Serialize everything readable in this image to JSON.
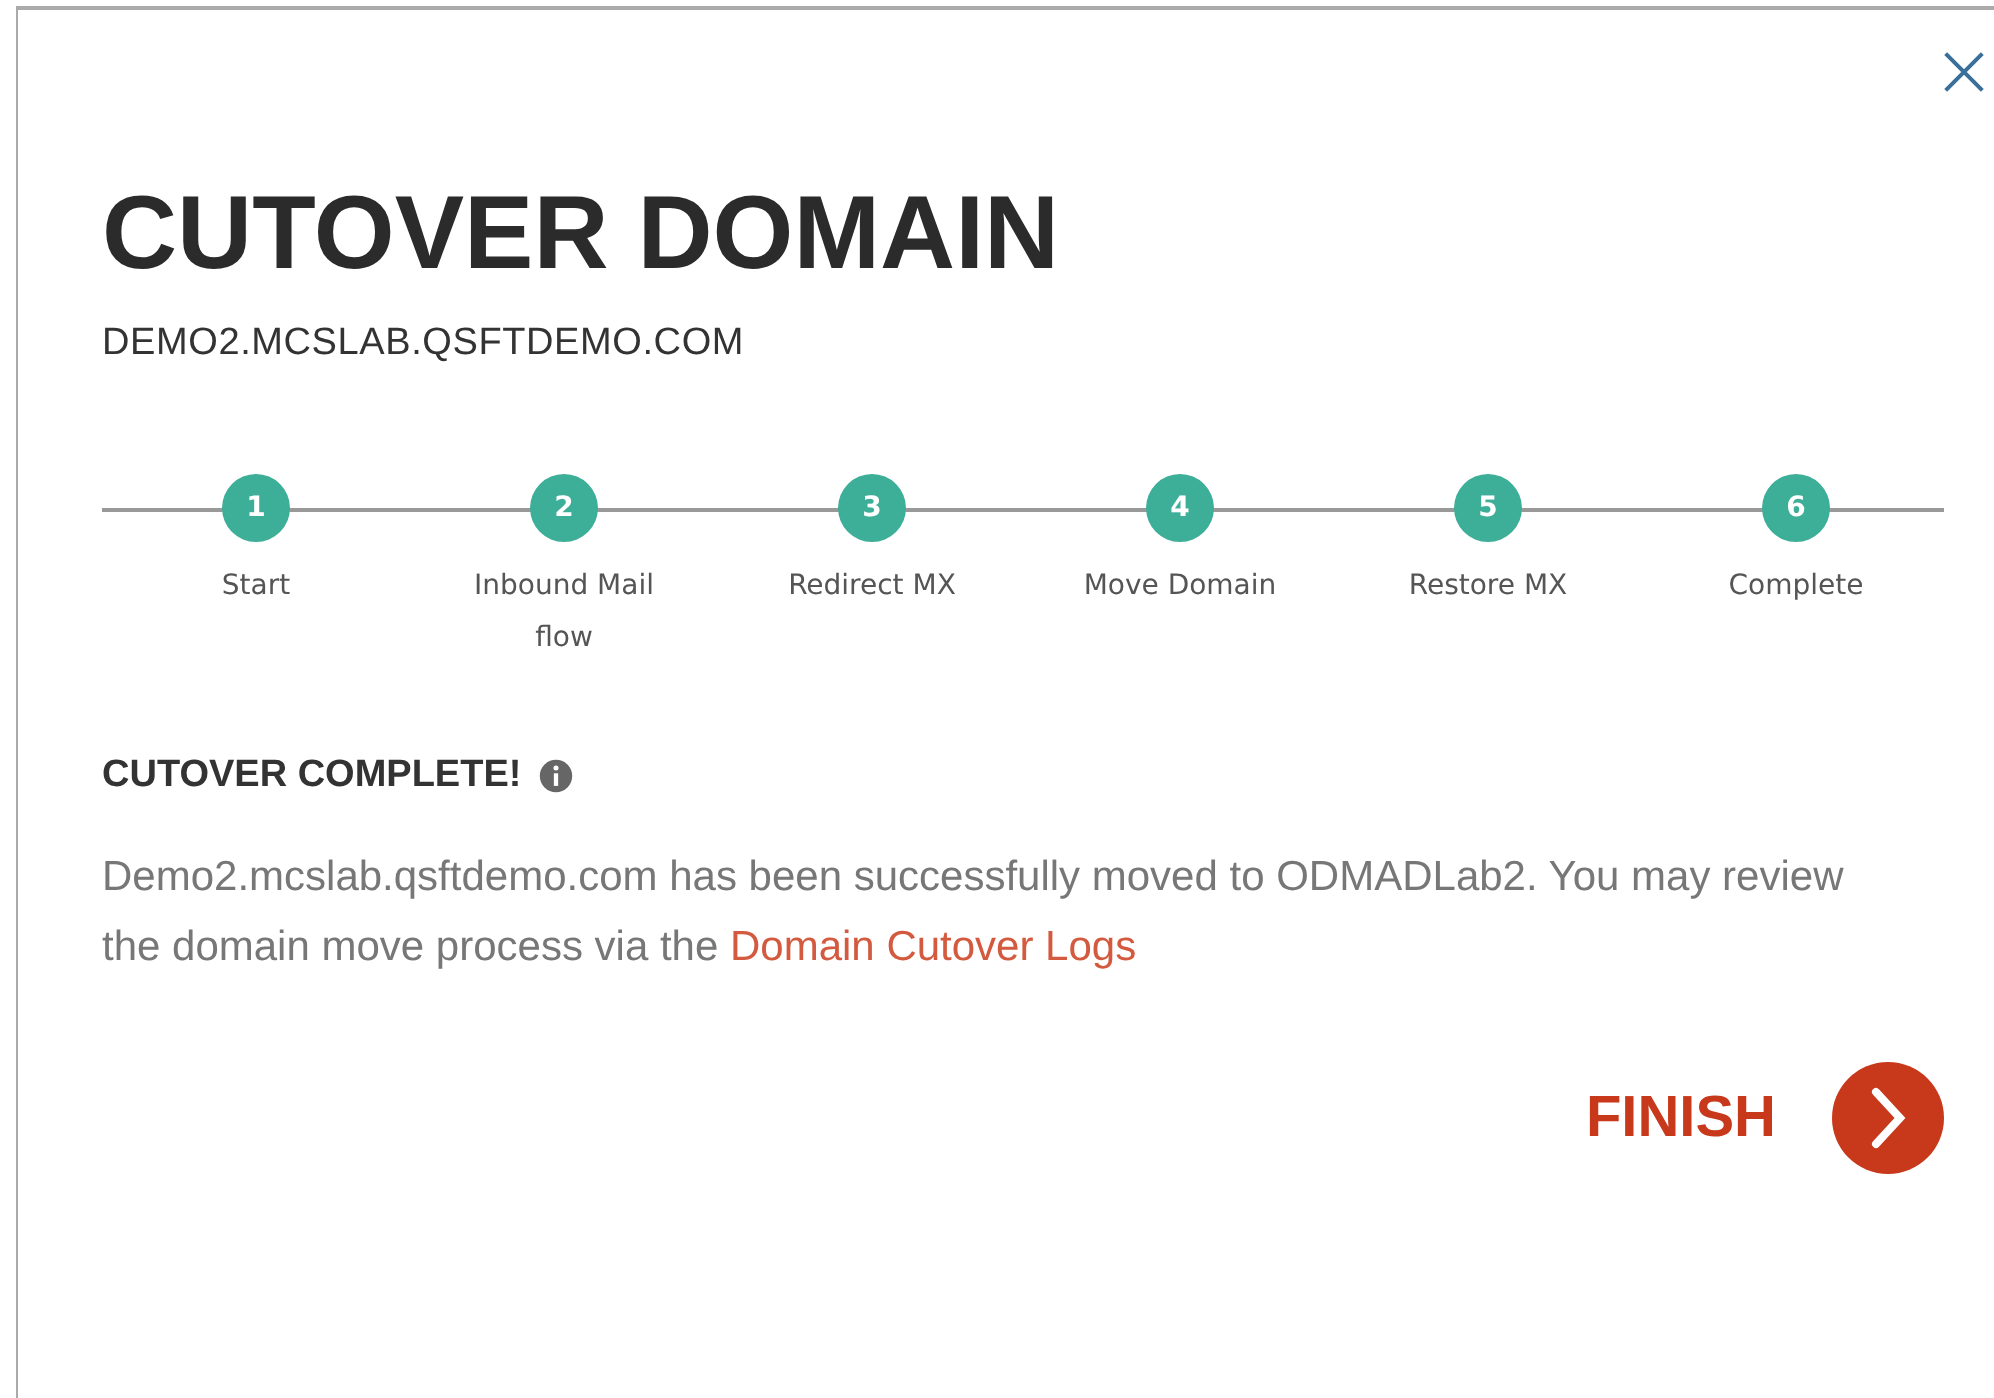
{
  "dialog": {
    "title": "CUTOVER DOMAIN",
    "subtitle": "DEMO2.MCSLAB.QSFTDEMO.COM"
  },
  "steps": [
    {
      "number": "1",
      "label": "Start",
      "done": true
    },
    {
      "number": "2",
      "label": "Inbound Mail flow",
      "done": true
    },
    {
      "number": "3",
      "label": "Redirect MX",
      "done": true
    },
    {
      "number": "4",
      "label": "Move Domain",
      "done": true
    },
    {
      "number": "5",
      "label": "Restore MX",
      "done": true
    },
    {
      "number": "6",
      "label": "Complete",
      "done": true
    }
  ],
  "result": {
    "heading": "CUTOVER COMPLETE!",
    "message": "Demo2.mcslab.qsftdemo.com has been successfully moved to ODMADLab2. You may review the domain move process via the",
    "link": "Domain Cutover Logs"
  },
  "finish_button": {
    "label": "FINISH"
  }
}
